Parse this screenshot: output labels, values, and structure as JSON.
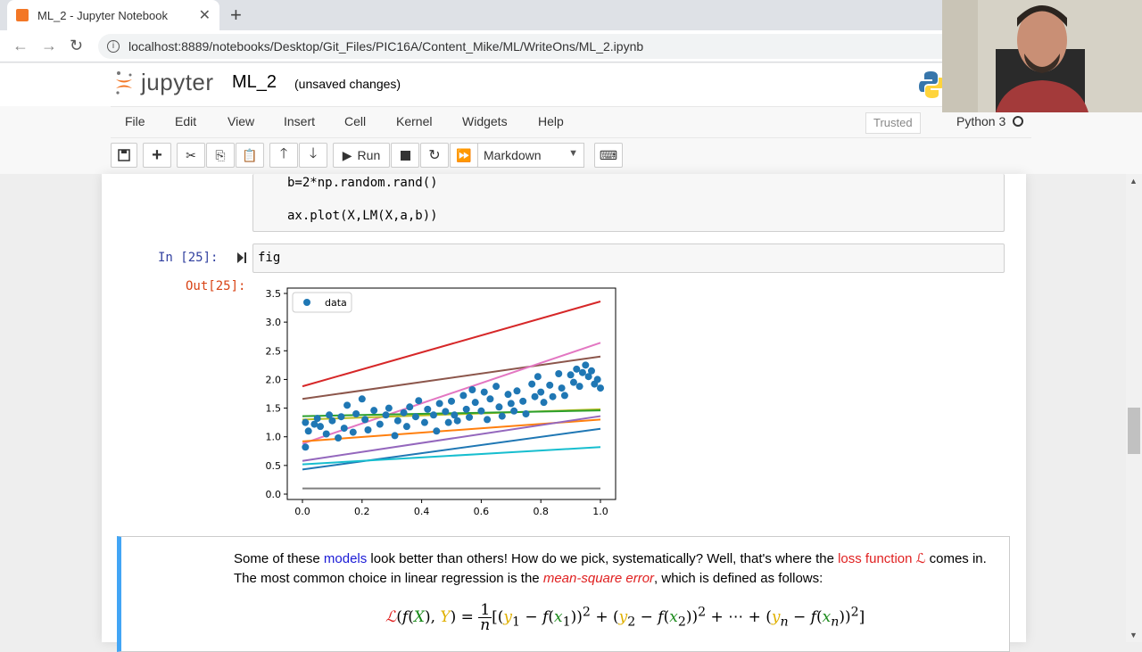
{
  "browser": {
    "tab_title": "ML_2 - Jupyter Notebook",
    "url": "localhost:8889/notebooks/Desktop/Git_Files/PIC16A/Content_Mike/ML/WriteOns/ML_2.ipynb"
  },
  "jupyter": {
    "logo_text": "jupyter",
    "notebook_name": "ML_2",
    "save_status": "(unsaved changes)",
    "menu": [
      "File",
      "Edit",
      "View",
      "Insert",
      "Cell",
      "Kernel",
      "Widgets",
      "Help"
    ],
    "trusted": "Trusted",
    "kernel": "Python 3",
    "toolbar": {
      "run_label": "Run",
      "cell_type": "Markdown"
    }
  },
  "cells": {
    "code1_lines": [
      "b=2*np.random.rand()",
      "ax.plot(X,LM(X,a,b))"
    ],
    "code2_prompt": "In [25]:",
    "code2_source": "fig",
    "out_prompt": "Out[25]:"
  },
  "chart_data": {
    "type": "scatter",
    "title": "",
    "xlabel": "",
    "ylabel": "",
    "xlim": [
      0,
      1
    ],
    "ylim": [
      0,
      3.5
    ],
    "xticks": [
      "0.0",
      "0.2",
      "0.4",
      "0.6",
      "0.8",
      "1.0"
    ],
    "yticks": [
      "0.0",
      "0.5",
      "1.0",
      "1.5",
      "2.0",
      "2.5",
      "3.0",
      "3.5"
    ],
    "legend": {
      "entries": [
        "data"
      ],
      "position": "top-left"
    },
    "scatter": {
      "name": "data",
      "color": "#1f77b4",
      "points": [
        [
          0.01,
          0.82
        ],
        [
          0.01,
          1.25
        ],
        [
          0.02,
          1.1
        ],
        [
          0.04,
          1.22
        ],
        [
          0.05,
          1.32
        ],
        [
          0.06,
          1.18
        ],
        [
          0.08,
          1.05
        ],
        [
          0.09,
          1.38
        ],
        [
          0.1,
          1.28
        ],
        [
          0.12,
          0.98
        ],
        [
          0.13,
          1.35
        ],
        [
          0.14,
          1.15
        ],
        [
          0.15,
          1.55
        ],
        [
          0.17,
          1.08
        ],
        [
          0.18,
          1.4
        ],
        [
          0.2,
          1.66
        ],
        [
          0.21,
          1.3
        ],
        [
          0.22,
          1.12
        ],
        [
          0.24,
          1.46
        ],
        [
          0.26,
          1.22
        ],
        [
          0.28,
          1.38
        ],
        [
          0.29,
          1.5
        ],
        [
          0.31,
          1.02
        ],
        [
          0.32,
          1.28
        ],
        [
          0.34,
          1.42
        ],
        [
          0.35,
          1.18
        ],
        [
          0.36,
          1.52
        ],
        [
          0.38,
          1.35
        ],
        [
          0.39,
          1.63
        ],
        [
          0.41,
          1.25
        ],
        [
          0.42,
          1.48
        ],
        [
          0.44,
          1.38
        ],
        [
          0.45,
          1.1
        ],
        [
          0.46,
          1.58
        ],
        [
          0.48,
          1.44
        ],
        [
          0.49,
          1.25
        ],
        [
          0.5,
          1.62
        ],
        [
          0.51,
          1.38
        ],
        [
          0.52,
          1.28
        ],
        [
          0.54,
          1.72
        ],
        [
          0.55,
          1.48
        ],
        [
          0.56,
          1.34
        ],
        [
          0.57,
          1.82
        ],
        [
          0.58,
          1.6
        ],
        [
          0.6,
          1.45
        ],
        [
          0.61,
          1.78
        ],
        [
          0.62,
          1.3
        ],
        [
          0.63,
          1.66
        ],
        [
          0.65,
          1.88
        ],
        [
          0.66,
          1.52
        ],
        [
          0.67,
          1.36
        ],
        [
          0.69,
          1.74
        ],
        [
          0.7,
          1.58
        ],
        [
          0.71,
          1.45
        ],
        [
          0.72,
          1.8
        ],
        [
          0.74,
          1.62
        ],
        [
          0.75,
          1.4
        ],
        [
          0.77,
          1.92
        ],
        [
          0.78,
          1.7
        ],
        [
          0.79,
          2.05
        ],
        [
          0.8,
          1.78
        ],
        [
          0.81,
          1.6
        ],
        [
          0.83,
          1.9
        ],
        [
          0.84,
          1.7
        ],
        [
          0.86,
          2.1
        ],
        [
          0.87,
          1.85
        ],
        [
          0.88,
          1.72
        ],
        [
          0.9,
          2.08
        ],
        [
          0.91,
          1.95
        ],
        [
          0.92,
          2.18
        ],
        [
          0.93,
          1.88
        ],
        [
          0.94,
          2.12
        ],
        [
          0.95,
          2.25
        ],
        [
          0.96,
          2.05
        ],
        [
          0.97,
          2.15
        ],
        [
          0.98,
          1.92
        ],
        [
          1.0,
          1.85
        ],
        [
          0.99,
          2.0
        ]
      ]
    },
    "series": [
      {
        "color": "#d62728",
        "values": [
          1.88,
          3.36
        ]
      },
      {
        "color": "#8c564b",
        "values": [
          1.66,
          2.4
        ]
      },
      {
        "color": "#e377c2",
        "values": [
          0.88,
          2.64
        ]
      },
      {
        "color": "#bcbd22",
        "values": [
          1.3,
          1.48
        ]
      },
      {
        "color": "#2ca02c",
        "values": [
          1.36,
          1.46
        ]
      },
      {
        "color": "#ff7f0e",
        "values": [
          0.92,
          1.3
        ]
      },
      {
        "color": "#9467bd",
        "values": [
          0.58,
          1.36
        ]
      },
      {
        "color": "#1f77b4",
        "values": [
          0.43,
          1.14
        ]
      },
      {
        "color": "#17becf",
        "values": [
          0.52,
          0.82
        ]
      },
      {
        "color": "#7f7f7f",
        "values": [
          0.1,
          0.1
        ]
      }
    ]
  },
  "markdown": {
    "p1": "Some of these ",
    "models": "models",
    "p2": " look better than others! How do we pick, systematically? Well, that's where the ",
    "loss": "loss function ",
    "lossL": "ℒ",
    "p3": " comes in. The most common choice in linear regression is the ",
    "mse": "mean-square error",
    "p4": ", which is defined as follows:"
  }
}
